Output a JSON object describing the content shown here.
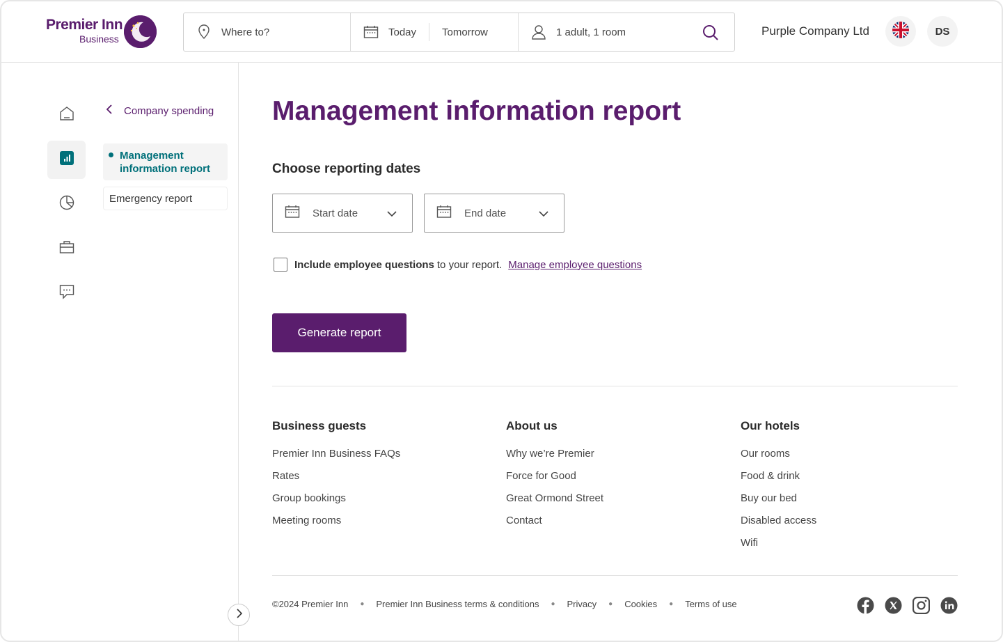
{
  "brand": {
    "line1": "Premier Inn",
    "line2": "Business",
    "color": "#5a1d6d"
  },
  "search": {
    "where_placeholder": "Where to?",
    "checkin": "Today",
    "checkout": "Tomorrow",
    "guests": "1 adult, 1 room"
  },
  "account": {
    "company": "Purple Company Ltd",
    "initials": "DS",
    "language_flag": "uk-flag-icon"
  },
  "sidebar": {
    "rail": [
      "home-icon",
      "report-chart-icon",
      "pie-chart-icon",
      "briefcase-icon",
      "chat-icon"
    ],
    "back_label": "Company spending",
    "items": [
      {
        "label": "Management information report",
        "active": true
      },
      {
        "label": "Emergency report",
        "active": false
      }
    ]
  },
  "main": {
    "title": "Management information report",
    "section": "Choose reporting dates",
    "start_placeholder": "Start date",
    "end_placeholder": "End date",
    "checkbox_bold": "Include employee questions",
    "checkbox_rest": "to your report.",
    "checkbox_checked": false,
    "manage_link": "Manage employee questions",
    "generate_label": "Generate report"
  },
  "footer": {
    "columns": [
      {
        "heading": "Business guests",
        "links": [
          "Premier Inn Business FAQs",
          "Rates",
          "Group bookings",
          "Meeting rooms"
        ]
      },
      {
        "heading": "About us",
        "links": [
          "Why we’re Premier",
          "Force for Good",
          "Great Ormond Street",
          "Contact"
        ]
      },
      {
        "heading": "Our hotels",
        "links": [
          "Our rooms",
          "Food & drink",
          "Buy our bed",
          "Disabled access",
          "Wifi"
        ]
      }
    ],
    "legal": [
      "©2024 Premier Inn",
      "Premier Inn Business terms & conditions",
      "Privacy",
      "Cookies",
      "Terms of use"
    ],
    "social": [
      "facebook-icon",
      "x-icon",
      "instagram-icon",
      "linkedin-icon"
    ]
  }
}
